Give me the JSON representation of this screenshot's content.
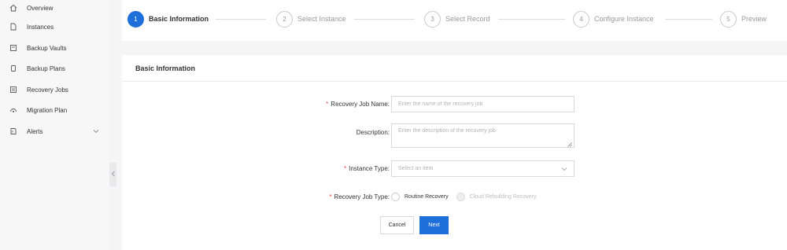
{
  "sidebar": {
    "items": [
      {
        "label": "Overview",
        "icon": "home-icon"
      },
      {
        "label": "Instances",
        "icon": "document-icon"
      },
      {
        "label": "Backup Vaults",
        "icon": "vault-icon"
      },
      {
        "label": "Backup Plans",
        "icon": "plan-icon"
      },
      {
        "label": "Recovery Jobs",
        "icon": "recovery-icon"
      },
      {
        "label": "Migration Plan",
        "icon": "migration-icon"
      },
      {
        "label": "Alerts",
        "icon": "alert-icon",
        "expandable": true
      }
    ]
  },
  "steps": [
    {
      "number": "1",
      "label": "Basic Information",
      "active": true
    },
    {
      "number": "2",
      "label": "Select Instance",
      "active": false
    },
    {
      "number": "3",
      "label": "Select Record",
      "active": false
    },
    {
      "number": "4",
      "label": "Configure Instance",
      "active": false
    },
    {
      "number": "5",
      "label": "Preview",
      "active": false
    }
  ],
  "form": {
    "section_title": "Basic Information",
    "required_mark": "*",
    "job_name": {
      "label": "Recovery Job Name:",
      "placeholder": "Enter the name of the recovery job",
      "value": ""
    },
    "description": {
      "label": "Description:",
      "placeholder": "Enter the description of the recovery job",
      "value": ""
    },
    "instance_type": {
      "label": "Instance Type:",
      "placeholder": "Select an item"
    },
    "job_type": {
      "label": "Recovery Job Type:",
      "options": [
        {
          "label": "Routine Recovery",
          "disabled": false
        },
        {
          "label": "Cloud Rebuilding Recovery",
          "disabled": true
        }
      ]
    },
    "cancel_label": "Cancel",
    "next_label": "Next"
  },
  "colors": {
    "accent": "#1e6fd9",
    "required": "#e8474a"
  }
}
